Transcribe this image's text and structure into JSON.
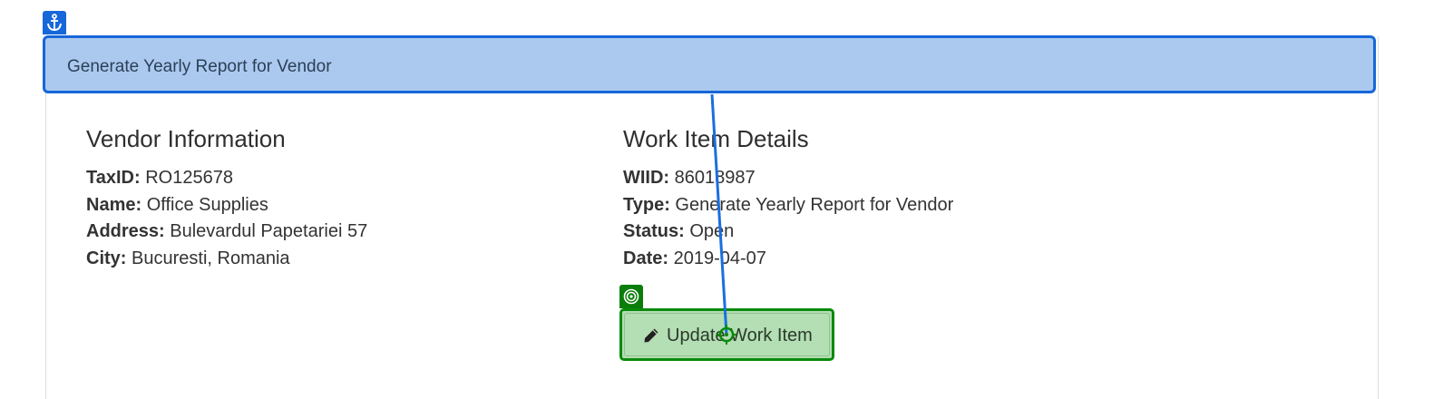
{
  "header": {
    "title": "Generate Yearly Report for Vendor"
  },
  "vendor": {
    "heading": "Vendor Information",
    "fields": [
      {
        "label": "TaxID:",
        "value": "RO125678"
      },
      {
        "label": "Name:",
        "value": "Office Supplies"
      },
      {
        "label": "Address:",
        "value": "Bulevardul Papetariei 57"
      },
      {
        "label": "City:",
        "value": "Bucuresti, Romania"
      }
    ]
  },
  "work_item": {
    "heading": "Work Item Details",
    "fields": [
      {
        "label": "WIID:",
        "value": "86018987"
      },
      {
        "label": "Type:",
        "value": "Generate Yearly Report for Vendor"
      },
      {
        "label": "Status:",
        "value": "Open"
      },
      {
        "label": "Date:",
        "value": "2019-04-07"
      }
    ]
  },
  "actions": {
    "update_label": "Update Work Item"
  },
  "icons": {
    "anchor": "anchor-icon",
    "target": "target-icon",
    "pencil": "pencil-icon",
    "crosshair": "crosshair-icon"
  },
  "colors": {
    "header_bg": "#abc9ef",
    "header_border": "#1667d9",
    "button_bg": "#b4deb4",
    "button_border": "#0a8a0a"
  }
}
